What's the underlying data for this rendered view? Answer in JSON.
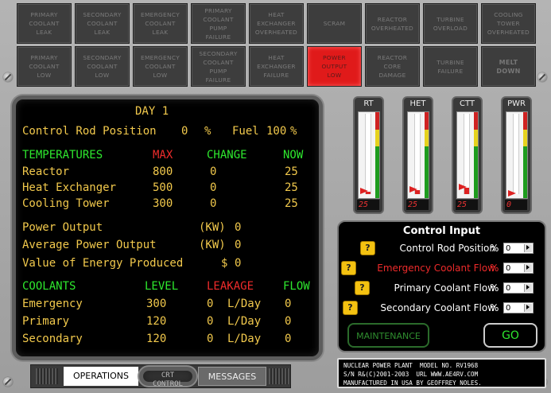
{
  "alarms_row1": [
    {
      "label": "PRIMARY\nCOOLANT\nLEAK",
      "active": false
    },
    {
      "label": "SECONDARY\nCOOLANT\nLEAK",
      "active": false
    },
    {
      "label": "EMERGENCY\nCOOLANT\nLEAK",
      "active": false
    },
    {
      "label": "PRIMARY\nCOOLANT\nPUMP\nFAILURE",
      "active": false
    },
    {
      "label": "HEAT\nEXCHANGER\nOVERHEATED",
      "active": false
    },
    {
      "label": "SCRAM",
      "active": false
    },
    {
      "label": "REACTOR\nOVERHEATED",
      "active": false
    },
    {
      "label": "TURBINE\nOVERLOAD",
      "active": false
    },
    {
      "label": "COOLING\nTOWER\nOVERHEATED",
      "active": false
    }
  ],
  "alarms_row2": [
    {
      "label": "PRIMARY\nCOOLANT\nLOW",
      "active": false
    },
    {
      "label": "SECONDARY\nCOOLANT\nLOW",
      "active": false
    },
    {
      "label": "EMERGENCY\nCOOLANT\nLOW",
      "active": false
    },
    {
      "label": "SECONDARY\nCOOLANT\nPUMP\nFAILURE",
      "active": false
    },
    {
      "label": "HEAT\nEXCHANGER\nFAILURE",
      "active": false
    },
    {
      "label": "POWER\nOUTPUT\nLOW",
      "active": true
    },
    {
      "label": "REACTOR\nCORE\nDAMAGE",
      "active": false
    },
    {
      "label": "TURBINE\nFAILURE",
      "active": false
    },
    {
      "label": "MELT\nDOWN",
      "active": false
    }
  ],
  "crt": {
    "day": "DAY 1",
    "control_rod_label": "Control Rod Position",
    "control_rod_value": "0",
    "control_rod_unit": "%",
    "fuel_label": "Fuel",
    "fuel_value": "100",
    "fuel_unit": "%",
    "temps_header": "TEMPERATURES",
    "max_header": "MAX",
    "change_header": "CHANGE",
    "now_header": "NOW",
    "temps": [
      {
        "name": "Reactor",
        "max": "800",
        "change": "0",
        "now": "25"
      },
      {
        "name": "Heat Exchanger",
        "max": "500",
        "change": "0",
        "now": "25"
      },
      {
        "name": "Cooling Tower",
        "max": "300",
        "change": "0",
        "now": "25"
      }
    ],
    "power_output_label": "Power Output",
    "power_output_unit": "(KW)",
    "power_output_value": "0",
    "avg_power_label": "Average Power Output",
    "avg_power_unit": "(KW)",
    "avg_power_value": "0",
    "energy_value_label": "Value of Energy Produced",
    "energy_value_unit": "$",
    "energy_value_value": "0",
    "coolants_header": "COOLANTS",
    "level_header": "LEVEL",
    "leakage_header": "LEAKAGE",
    "flow_header": "FLOW",
    "coolants": [
      {
        "name": "Emergency",
        "level": "300",
        "leakage": "0",
        "unit": "L/Day",
        "flow": "0"
      },
      {
        "name": "Primary",
        "level": "120",
        "leakage": "0",
        "unit": "L/Day",
        "flow": "0"
      },
      {
        "name": "Secondary",
        "level": "120",
        "leakage": "0",
        "unit": "L/Day",
        "flow": "0"
      }
    ]
  },
  "gauges": [
    {
      "label": "RT",
      "reading": "25",
      "level_fraction": 0.03
    },
    {
      "label": "HET",
      "reading": "25",
      "level_fraction": 0.05
    },
    {
      "label": "CTT",
      "reading": "25",
      "level_fraction": 0.08
    },
    {
      "label": "PWR",
      "reading": "0",
      "level_fraction": 0.0
    }
  ],
  "control_input": {
    "title": "Control Input",
    "rows": [
      {
        "help": "?",
        "label": "Control Rod Position",
        "color": "#ffffff",
        "unit": "%",
        "value": "0"
      },
      {
        "help": "?",
        "label": "Emergency Coolant Flow",
        "color": "#ee2b2b",
        "unit": "%",
        "value": "0"
      },
      {
        "help": "?",
        "label": "Primary Coolant Flow",
        "color": "#ffffff",
        "unit": "%",
        "value": "0"
      },
      {
        "help": "?",
        "label": "Secondary Coolant Flow",
        "color": "#ffffff",
        "unit": "%",
        "value": "0"
      }
    ],
    "maintenance_label": "MAINTENANCE",
    "go_label": "GO"
  },
  "tabs": {
    "operations": "OPERATIONS",
    "crt_control_line1": "CRT",
    "crt_control_line2": "CONTROL",
    "messages": "MESSAGES"
  },
  "nameplate": {
    "line1": "NUCLEAR POWER PLANT  MODEL NO. RV1968",
    "line2": "S/N R&(C)2001-2003  URL WWW.AE4RV.COM",
    "line3": "MANUFACTURED IN USA BY GEOFFREY NOLES."
  }
}
